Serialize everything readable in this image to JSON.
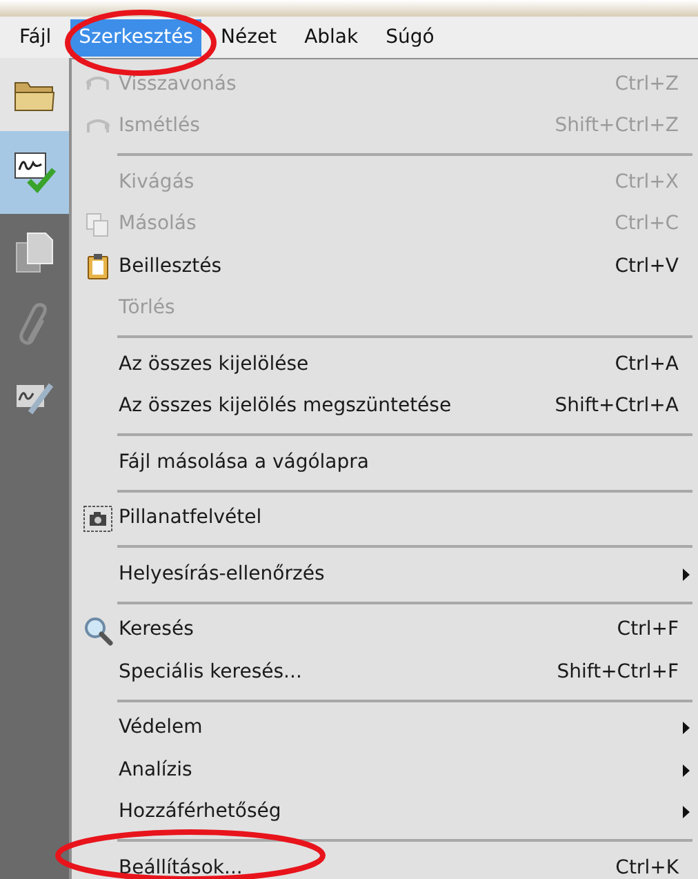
{
  "menubar": [
    {
      "label": "Fájl",
      "selected": false
    },
    {
      "label": "Szerkesztés",
      "selected": true
    },
    {
      "label": "Nézet",
      "selected": false
    },
    {
      "label": "Ablak",
      "selected": false
    },
    {
      "label": "Súgó",
      "selected": false
    }
  ],
  "menu": [
    {
      "kind": "undo",
      "label": "Visszavonás",
      "shortcut": "Ctrl+Z",
      "disabled": true
    },
    {
      "kind": "redo",
      "label": "Ismétlés",
      "shortcut": "Shift+Ctrl+Z",
      "disabled": true
    },
    {
      "kind": "separator"
    },
    {
      "kind": "plain",
      "label": "Kivágás",
      "shortcut": "Ctrl+X",
      "disabled": true
    },
    {
      "kind": "copy",
      "label": "Másolás",
      "shortcut": "Ctrl+C",
      "disabled": true
    },
    {
      "kind": "paste",
      "label": "Beillesztés",
      "shortcut": "Ctrl+V",
      "disabled": false
    },
    {
      "kind": "plain",
      "label": "Törlés",
      "disabled": true
    },
    {
      "kind": "separator"
    },
    {
      "kind": "plain",
      "label": "Az összes kijelölése",
      "shortcut": "Ctrl+A",
      "disabled": false
    },
    {
      "kind": "plain",
      "label": "Az összes kijelölés megszüntetése",
      "shortcut": "Shift+Ctrl+A",
      "disabled": false
    },
    {
      "kind": "separator"
    },
    {
      "kind": "plain",
      "label": "Fájl másolása a vágólapra",
      "disabled": false
    },
    {
      "kind": "separator"
    },
    {
      "kind": "snapshot",
      "label": "Pillanatfelvétel",
      "disabled": false
    },
    {
      "kind": "separator"
    },
    {
      "kind": "plain",
      "label": "Helyesírás-ellenőrzés",
      "disabled": false,
      "submenu": true
    },
    {
      "kind": "separator"
    },
    {
      "kind": "search",
      "label": "Keresés",
      "shortcut": "Ctrl+F",
      "disabled": false
    },
    {
      "kind": "plain",
      "label": "Speciális keresés...",
      "shortcut": "Shift+Ctrl+F",
      "disabled": false
    },
    {
      "kind": "separator"
    },
    {
      "kind": "plain",
      "label": "Védelem",
      "disabled": false,
      "submenu": true
    },
    {
      "kind": "plain",
      "label": "Analízis",
      "disabled": false,
      "submenu": true
    },
    {
      "kind": "plain",
      "label": "Hozzáférhetőség",
      "disabled": false,
      "submenu": true
    },
    {
      "kind": "separator"
    },
    {
      "kind": "plain",
      "label": "Beállítások...",
      "shortcut": "Ctrl+K",
      "disabled": false
    }
  ]
}
